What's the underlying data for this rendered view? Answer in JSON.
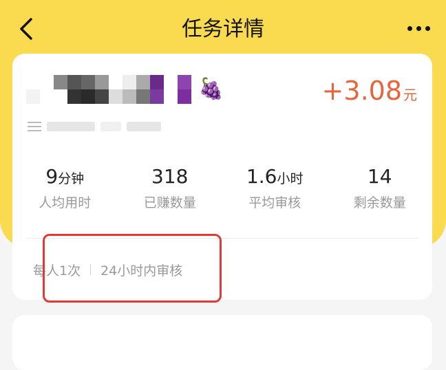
{
  "header": {
    "title": "任务详情"
  },
  "task": {
    "reward_amount": "+3.08",
    "reward_unit": "元"
  },
  "stats": [
    {
      "value": "9",
      "unit": "分钟",
      "label": "人均用时"
    },
    {
      "value": "318",
      "unit": "",
      "label": "已赚数量"
    },
    {
      "value": "1.6",
      "unit": "小时",
      "label": "平均审核"
    },
    {
      "value": "14",
      "unit": "",
      "label": "剩余数量"
    }
  ],
  "tags": {
    "limit": "每人1次",
    "review": "24小时内审核"
  },
  "colors": {
    "header_bg": "#fadb4f",
    "reward": "#e8643a",
    "highlight": "#e53935"
  },
  "icons": {
    "back": "chevron-left-icon",
    "more": "more-dots-icon",
    "task": "grape-icon",
    "list": "list-icon"
  }
}
